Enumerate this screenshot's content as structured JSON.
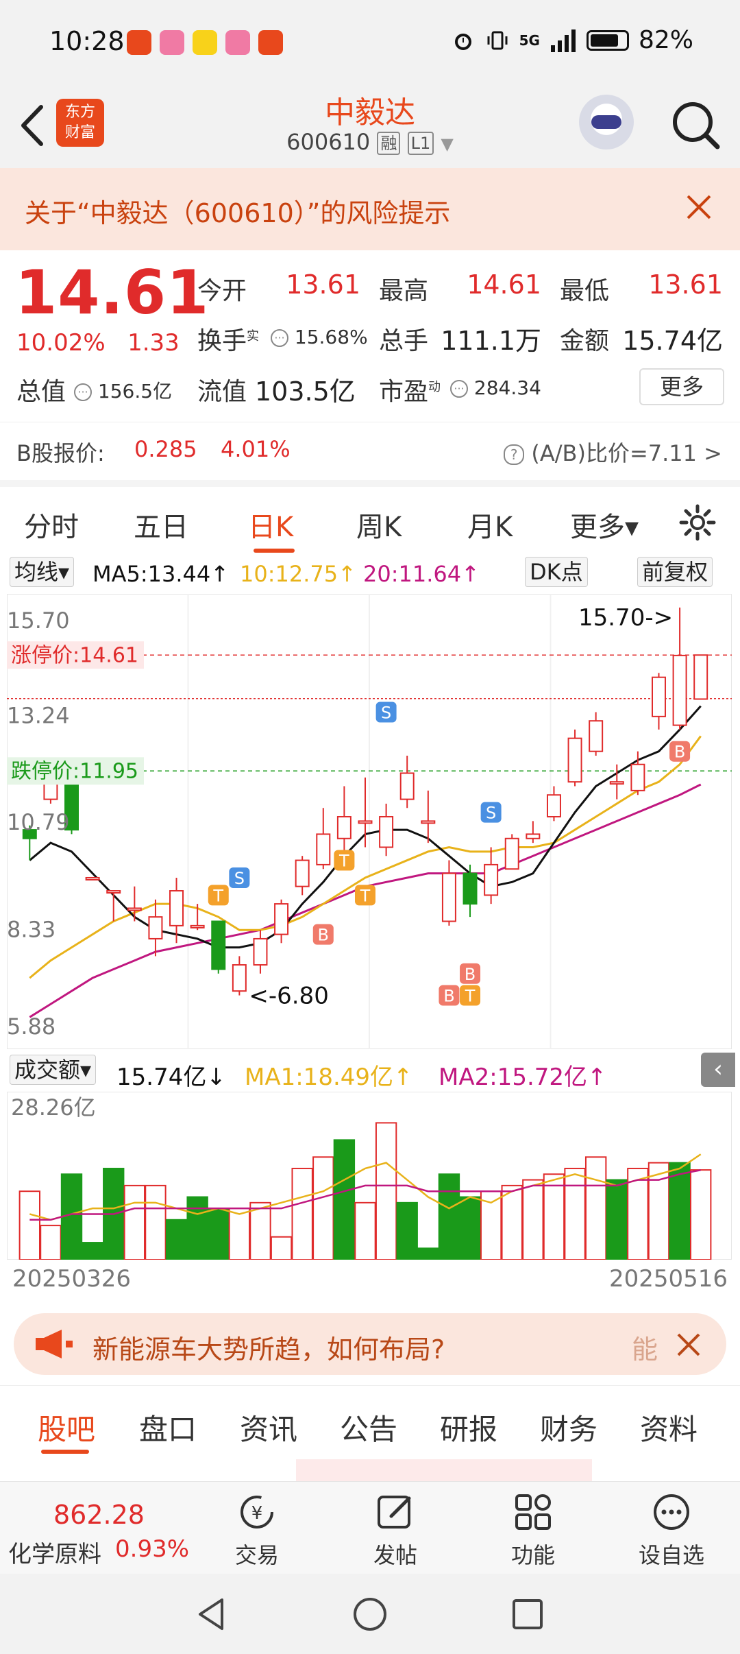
{
  "status_bar": {
    "time": "10:28",
    "network": "5G",
    "battery": "82%"
  },
  "header": {
    "logo_text": "东方\n财富",
    "stock_name": "中毅达",
    "stock_code": "600610",
    "tag_margin": "融",
    "tag_level": "L1"
  },
  "risk_banner": {
    "text": "关于“中毅达（600610）”的风险提示"
  },
  "quote": {
    "price": "14.61",
    "change_pct": "10.02%",
    "change": "1.33",
    "open_label": "今开",
    "open": "13.61",
    "high_label": "最高",
    "high": "14.61",
    "low_label": "最低",
    "low": "13.61",
    "turnover_label": "换手",
    "turnover_sup": "实",
    "turnover": "15.68%",
    "volume_label": "总手",
    "volume": "111.1万",
    "amount_label": "金额",
    "amount": "15.74亿",
    "total_cap_label": "总值",
    "total_cap": "156.5亿",
    "float_cap_label": "流值",
    "float_cap": "103.5亿",
    "pe_label": "市盈",
    "pe_sup": "动",
    "pe": "284.34",
    "more_label": "更多"
  },
  "b_share": {
    "label": "B股报价:",
    "price": "0.285",
    "pct": "4.01%",
    "ratio": "(A/B)比价=7.11 >"
  },
  "period_tabs": [
    {
      "label": "分时"
    },
    {
      "label": "五日"
    },
    {
      "label": "日K"
    },
    {
      "label": "周K"
    },
    {
      "label": "月K"
    },
    {
      "label": "更多▾"
    }
  ],
  "ma_bar": {
    "selector": "均线▾",
    "ma5": "MA5:13.44↑",
    "ma10": "10:12.75↑",
    "ma20": "20:11.64↑",
    "dk": "DK点",
    "adjust": "前复权"
  },
  "colors": {
    "up": "#e02b2b",
    "down": "#1a9a1a",
    "brand": "#e8481c",
    "ma5": "#111111",
    "ma10": "#e8b21a",
    "ma20": "#c0177f"
  },
  "chart_data": {
    "type": "candlestick",
    "y_ticks": [
      "15.70",
      "13.24",
      "10.79",
      "8.33",
      "5.88"
    ],
    "ylim": [
      5.88,
      15.7
    ],
    "limit_up_label": "涨停价:14.61",
    "limit_up": 14.61,
    "limit_down_label": "跌停价:11.95",
    "limit_down": 11.95,
    "max_annotation": "15.70->",
    "min_annotation": "<-6.80",
    "candles": [
      {
        "o": 10.6,
        "c": 10.4,
        "h": 10.7,
        "l": 9.9
      },
      {
        "o": 11.3,
        "c": 11.8,
        "h": 11.9,
        "l": 11.2
      },
      {
        "o": 11.8,
        "c": 10.6,
        "h": 11.8,
        "l": 10.5
      },
      {
        "o": 9.5,
        "c": 9.5,
        "h": 9.5,
        "l": 9.5
      },
      {
        "o": 9.2,
        "c": 9.2,
        "h": 9.2,
        "l": 8.5
      },
      {
        "o": 8.8,
        "c": 8.8,
        "h": 9.3,
        "l": 8.5
      },
      {
        "o": 8.1,
        "c": 8.6,
        "h": 9.0,
        "l": 7.7
      },
      {
        "o": 8.4,
        "c": 9.2,
        "h": 9.5,
        "l": 8.0
      },
      {
        "o": 8.4,
        "c": 8.4,
        "h": 8.9,
        "l": 8.3
      },
      {
        "o": 8.5,
        "c": 7.4,
        "h": 8.5,
        "l": 7.3
      },
      {
        "o": 6.9,
        "c": 7.5,
        "h": 7.7,
        "l": 6.8
      },
      {
        "o": 7.5,
        "c": 8.1,
        "h": 8.3,
        "l": 7.3
      },
      {
        "o": 8.2,
        "c": 8.9,
        "h": 9.0,
        "l": 8.0
      },
      {
        "o": 9.3,
        "c": 9.9,
        "h": 10.0,
        "l": 9.1
      },
      {
        "o": 9.8,
        "c": 10.5,
        "h": 11.1,
        "l": 9.7
      },
      {
        "o": 10.4,
        "c": 10.9,
        "h": 11.6,
        "l": 9.9
      },
      {
        "o": 10.8,
        "c": 10.8,
        "h": 11.8,
        "l": 10.2
      },
      {
        "o": 10.2,
        "c": 10.9,
        "h": 11.2,
        "l": 10.0
      },
      {
        "o": 11.3,
        "c": 11.9,
        "h": 12.3,
        "l": 11.1
      },
      {
        "o": 10.8,
        "c": 10.8,
        "h": 11.5,
        "l": 10.3
      },
      {
        "o": 8.5,
        "c": 9.6,
        "h": 9.9,
        "l": 8.4
      },
      {
        "o": 9.6,
        "c": 8.9,
        "h": 9.8,
        "l": 8.6
      },
      {
        "o": 9.1,
        "c": 9.8,
        "h": 10.2,
        "l": 8.9
      },
      {
        "o": 9.7,
        "c": 10.4,
        "h": 10.5,
        "l": 9.7
      },
      {
        "o": 10.4,
        "c": 10.5,
        "h": 10.8,
        "l": 10.3
      },
      {
        "o": 10.9,
        "c": 11.4,
        "h": 11.6,
        "l": 10.8
      },
      {
        "o": 11.7,
        "c": 12.7,
        "h": 12.9,
        "l": 11.6
      },
      {
        "o": 12.4,
        "c": 13.1,
        "h": 13.3,
        "l": 12.3
      },
      {
        "o": 11.7,
        "c": 11.7,
        "h": 12.1,
        "l": 11.3
      },
      {
        "o": 11.5,
        "c": 12.1,
        "h": 12.4,
        "l": 11.4
      },
      {
        "o": 13.2,
        "c": 14.1,
        "h": 14.2,
        "l": 12.9
      },
      {
        "o": 13.0,
        "c": 14.6,
        "h": 15.7,
        "l": 12.9
      },
      {
        "o": 13.6,
        "c": 14.61,
        "h": 14.61,
        "l": 13.61
      }
    ],
    "ma5": [
      9.9,
      10.3,
      10.1,
      9.6,
      9.1,
      8.6,
      8.3,
      8.2,
      8.1,
      7.9,
      7.9,
      8.0,
      8.3,
      8.9,
      9.4,
      10.0,
      10.5,
      10.6,
      10.6,
      10.4,
      10.0,
      9.6,
      9.3,
      9.4,
      9.6,
      10.3,
      11.0,
      11.6,
      11.9,
      12.2,
      12.4,
      12.9,
      13.44
    ],
    "ma10": [
      7.2,
      7.6,
      7.9,
      8.2,
      8.5,
      8.7,
      8.9,
      8.9,
      8.8,
      8.6,
      8.3,
      8.3,
      8.4,
      8.6,
      8.9,
      9.2,
      9.5,
      9.7,
      9.9,
      10.1,
      10.2,
      10.1,
      10.1,
      10.2,
      10.2,
      10.3,
      10.6,
      10.9,
      11.2,
      11.5,
      11.7,
      12.1,
      12.75
    ],
    "ma20": [
      6.3,
      6.6,
      6.9,
      7.2,
      7.4,
      7.6,
      7.8,
      7.9,
      8.0,
      8.1,
      8.2,
      8.3,
      8.5,
      8.7,
      8.9,
      9.1,
      9.3,
      9.4,
      9.5,
      9.6,
      9.6,
      9.6,
      9.6,
      9.8,
      10.0,
      10.2,
      10.4,
      10.6,
      10.8,
      11.0,
      11.2,
      11.4,
      11.64
    ],
    "signals": [
      {
        "label": "T"
      },
      {
        "label": "S"
      },
      {
        "label": "B"
      },
      {
        "label": "B"
      },
      {
        "label": "T"
      },
      {
        "label": "T"
      },
      {
        "label": "S"
      },
      {
        "label": "B"
      },
      {
        "label": "T"
      },
      {
        "label": "S"
      },
      {
        "label": "B"
      }
    ]
  },
  "volume_bar": {
    "selector": "成交额▾",
    "value": "15.74亿↓",
    "ma1": "MA1:18.49亿↑",
    "ma2": "MA2:15.72亿↑",
    "y_max_label": "28.26亿"
  },
  "volume_data": {
    "unit": "亿",
    "values": [
      12,
      6,
      15,
      3,
      16,
      13,
      13,
      7,
      11,
      9,
      9,
      10,
      4,
      16,
      18,
      21,
      10,
      24,
      10,
      2,
      15,
      11,
      12,
      13,
      14,
      15,
      16,
      18,
      14,
      16,
      17,
      17,
      15.74
    ],
    "up": [
      true,
      true,
      false,
      false,
      false,
      true,
      true,
      false,
      false,
      false,
      true,
      true,
      true,
      true,
      true,
      false,
      true,
      true,
      false,
      false,
      false,
      false,
      true,
      true,
      true,
      true,
      true,
      true,
      false,
      true,
      true,
      false,
      true
    ],
    "ma1": [
      8,
      7,
      8,
      9,
      9,
      10,
      10,
      9,
      8,
      9,
      8,
      9,
      10,
      11,
      12,
      14,
      16,
      17,
      14,
      11,
      9,
      11,
      10,
      12,
      13,
      14,
      15,
      14,
      13,
      14,
      15,
      16,
      18.49
    ],
    "ma2": [
      7,
      7,
      8,
      8,
      8,
      9,
      9,
      9,
      9,
      9,
      9,
      9,
      9,
      10,
      11,
      12,
      13,
      13,
      13,
      12,
      12,
      12,
      12,
      12,
      13,
      13,
      13,
      13,
      13,
      14,
      14,
      15,
      15.72
    ]
  },
  "dates": {
    "start": "20250326",
    "end": "20250516"
  },
  "ad": {
    "text": "新能源车大势所趋，如何布局?",
    "tail": "能"
  },
  "bottom_tabs": [
    {
      "label": "股吧"
    },
    {
      "label": "盘口"
    },
    {
      "label": "资讯"
    },
    {
      "label": "公告"
    },
    {
      "label": "研报"
    },
    {
      "label": "财务"
    },
    {
      "label": "资料"
    }
  ],
  "toolbar": {
    "index_value": "862.28",
    "index_name": "化学原料",
    "index_pct": "0.93%",
    "trade_label": "交易",
    "post_label": "发帖",
    "func_label": "功能",
    "watch_label": "设自选"
  }
}
